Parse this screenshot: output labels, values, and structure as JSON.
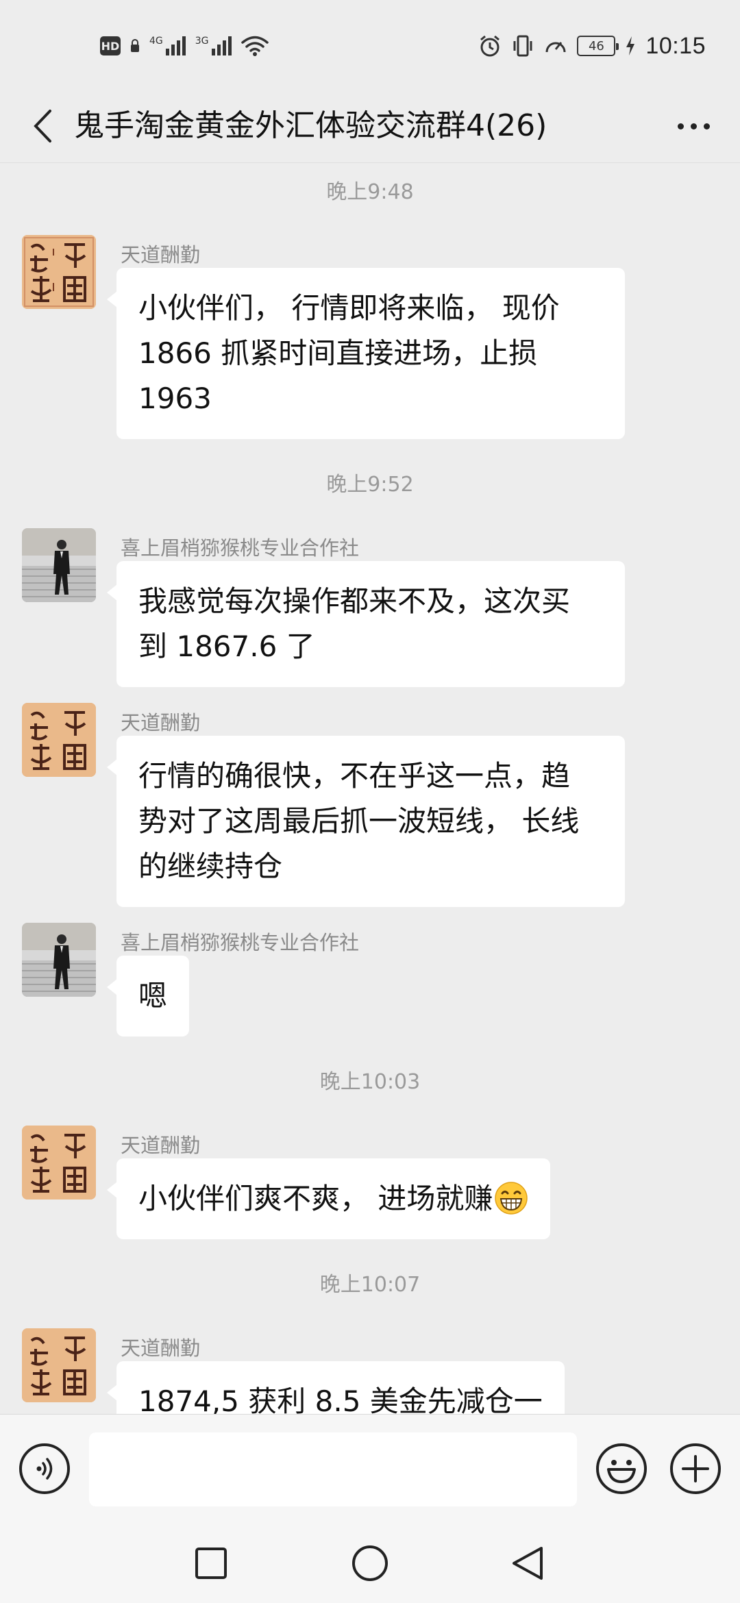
{
  "status_bar": {
    "hd_label": "HD",
    "network_1": "4G",
    "network_2": "3G",
    "battery": "46",
    "time": "10:15",
    "icons": [
      "wifi-icon",
      "alarm-icon",
      "vibrate-icon",
      "speed-icon",
      "charging-icon"
    ]
  },
  "header": {
    "title": "鬼手淘金黄金外汇体验交流群4(26)",
    "back_icon": "chevron-left-icon",
    "more_icon": "more-dots-icon"
  },
  "messages": [
    {
      "type": "time",
      "text": "晚上9:48"
    },
    {
      "type": "msg",
      "sender": "天道酬勤",
      "avatar": "seal-avatar",
      "lines": [
        "小伙伴们， 行情即将来临，  现价",
        "1866 抓紧时间直接进场，止损",
        "1963"
      ]
    },
    {
      "type": "time",
      "text": "晚上9:52"
    },
    {
      "type": "msg",
      "sender": "喜上眉梢猕猴桃专业合作社",
      "avatar": "photo-avatar",
      "lines": [
        "我感觉每次操作都来不及，这次买",
        "到 1867.6 了"
      ]
    },
    {
      "type": "msg",
      "sender": "天道酬勤",
      "avatar": "seal-avatar",
      "lines": [
        "行情的确很快，不在乎这一点，趋",
        "势对了这周最后抓一波短线， 长线",
        "的继续持仓"
      ]
    },
    {
      "type": "msg",
      "sender": "喜上眉梢猕猴桃专业合作社",
      "avatar": "photo-avatar",
      "lines": [
        "嗯"
      ]
    },
    {
      "type": "time",
      "text": "晚上10:03"
    },
    {
      "type": "msg",
      "sender": "天道酬勤",
      "avatar": "seal-avatar",
      "lines": [
        "小伙伴们爽不爽，  进场就赚"
      ],
      "emoji": "grinning-emoji"
    },
    {
      "type": "time",
      "text": "晚上10:07"
    },
    {
      "type": "msg",
      "sender": "天道酬勤",
      "avatar": "seal-avatar",
      "lines": [
        "1874,5   获利 8.5 美金先减仓一"
      ]
    }
  ],
  "input_bar": {
    "placeholder": "",
    "voice_icon": "voice-icon",
    "emoji_icon": "emoji-icon",
    "plus_icon": "plus-icon"
  },
  "nav_bar": {
    "icons": [
      "recents-square-icon",
      "home-circle-icon",
      "back-triangle-icon"
    ]
  },
  "colors": {
    "background": "#ededed",
    "bubble": "#ffffff",
    "timestamp": "#9a9a9a",
    "sender": "#8a8a8a"
  }
}
